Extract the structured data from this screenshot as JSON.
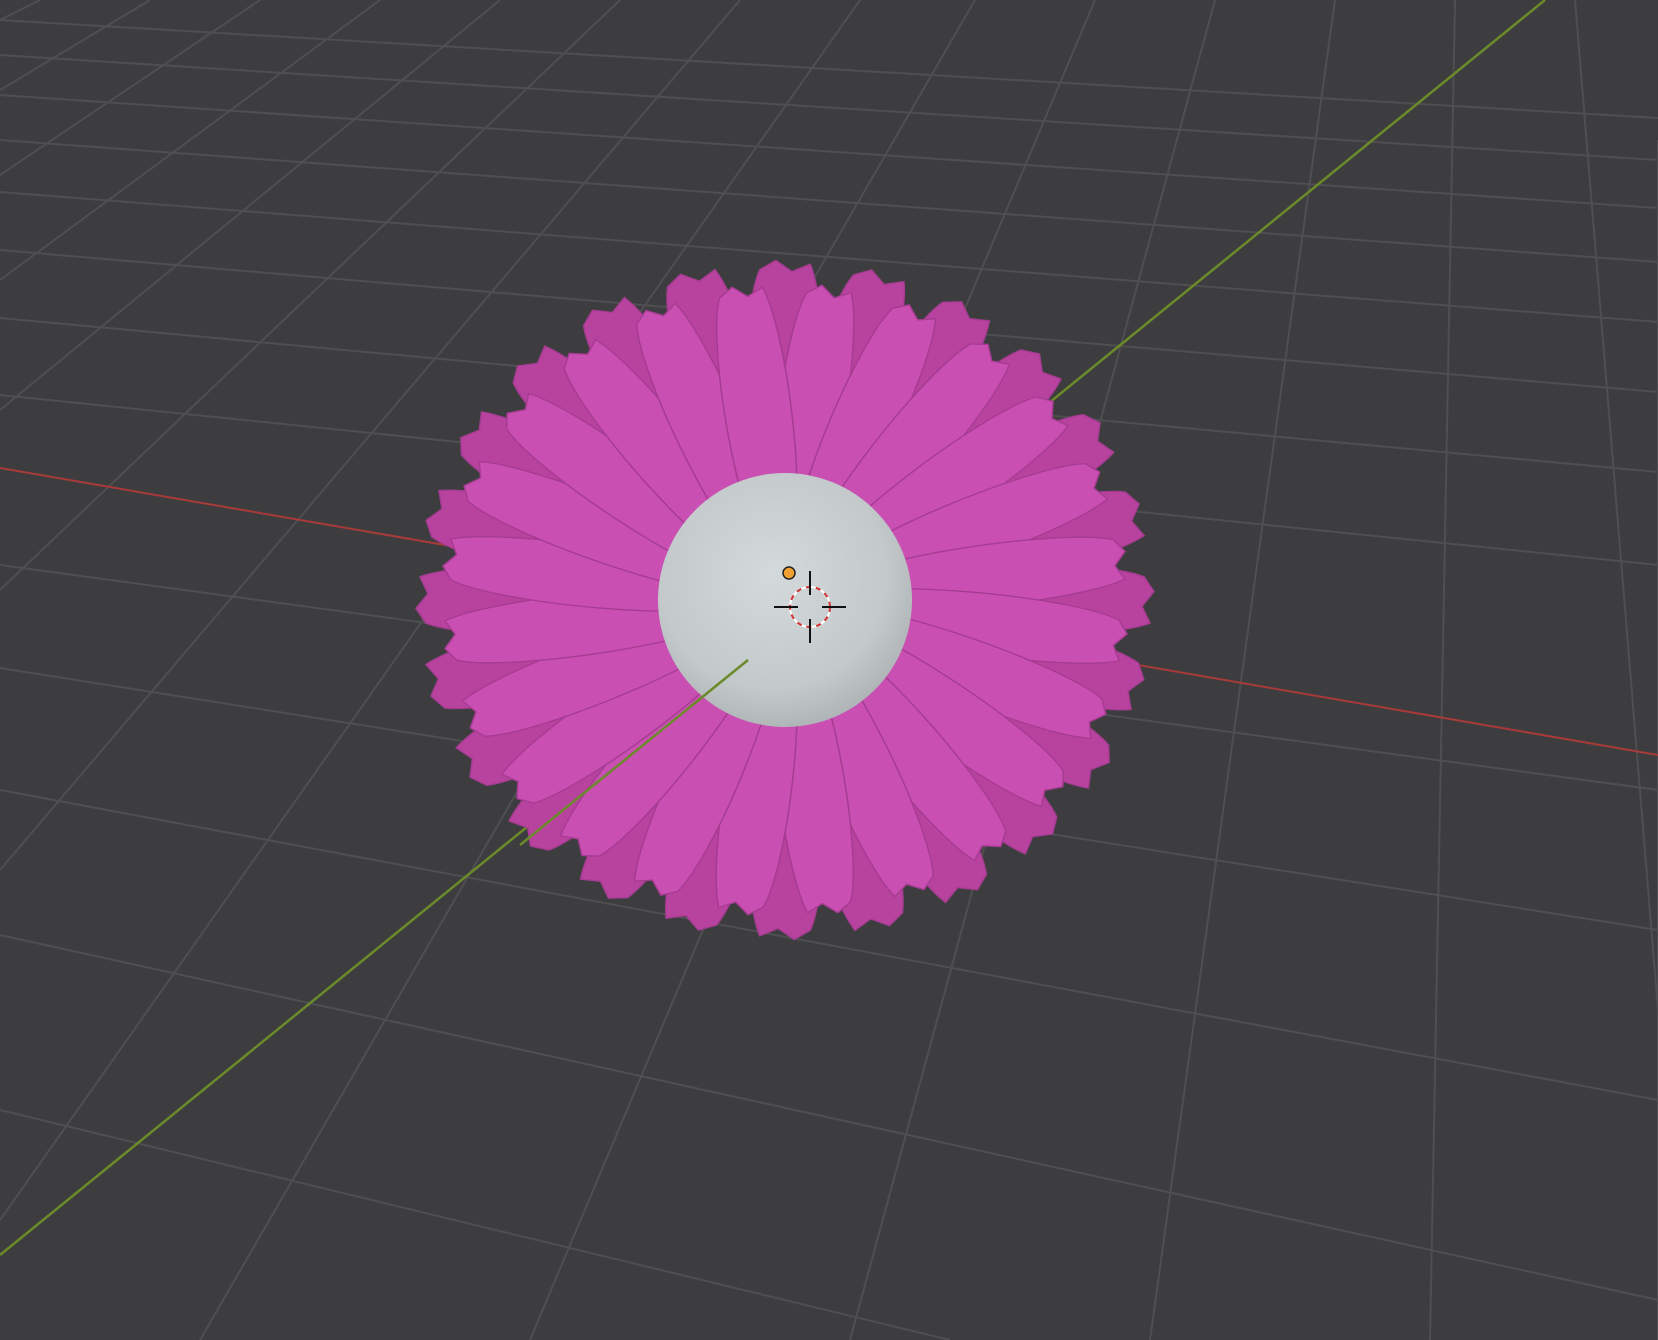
{
  "viewport": {
    "background_color": "#3d3d3f",
    "grid_color": "#4f4f52",
    "x_axis_color": "#a83a3a",
    "y_axis_color": "#6b8a2a",
    "petal_color": "#c94fb2",
    "petal_shade_color": "#b8439f",
    "center_color": "#c5cbcc",
    "origin_dot_color": "#f0a030"
  },
  "scene": {
    "objects": [
      "flower-petals",
      "flower-center-sphere"
    ],
    "cursor_icon": "3d-cursor-icon",
    "origin_icon": "object-origin-icon"
  }
}
